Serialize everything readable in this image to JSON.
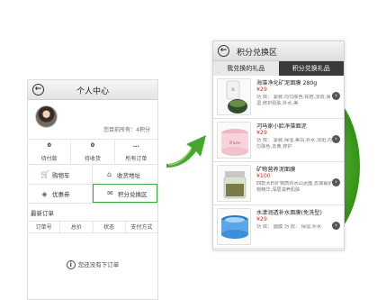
{
  "left_screen": {
    "title": "个人中心",
    "points_text": "您目前所有：4积分",
    "stats": [
      {
        "num": "0",
        "label": "待付款"
      },
      {
        "num": "0",
        "label": "待收货"
      },
      {
        "num": "...",
        "label": "所有订单"
      }
    ],
    "menu": [
      {
        "label": "购物车",
        "icon": "cart-icon"
      },
      {
        "label": "收货地址",
        "icon": "address-icon"
      },
      {
        "label": "优惠券",
        "icon": "coupon-icon"
      },
      {
        "label": "积分兑换区",
        "icon": "exchange-icon"
      }
    ],
    "orders_title": "最新订单",
    "orders_columns": [
      "订单号",
      "总价",
      "状态",
      "支付方式"
    ],
    "empty_text": "您还没有下订单"
  },
  "right_screen": {
    "title": "积分兑换区",
    "tabs": [
      "我兑换的礼品",
      "积分兑换礼品"
    ],
    "products": [
      {
        "name": "海藻净化矿泥面膜 280g",
        "price": "¥29",
        "desc": "功 效： 紧致,均匀肤色,祛痘,淡斑,保湿,修护肌肤,补水,美"
      },
      {
        "name": "河马家小脸净藻面泥",
        "price": "¥29",
        "desc": "功 效： 紧致,保湿,美白,补水,淡斑,均匀肤色,去黄,修护"
      },
      {
        "name": "矿物营养泥面膜",
        "price": "¥100",
        "desc": "四款大料矿物质的水山泥面,去掉最矿物精华,深层滋养肌肤"
      },
      {
        "name": "水漾润透补水面膜(免洗型)",
        "price": "¥29",
        "desc": "功 效： 面膜 功 效： 保湿,补水"
      }
    ]
  },
  "colors": {
    "accent_green": "#3aa83a",
    "price_red": "#e02020",
    "dark_tab": "#3a3a3a"
  }
}
